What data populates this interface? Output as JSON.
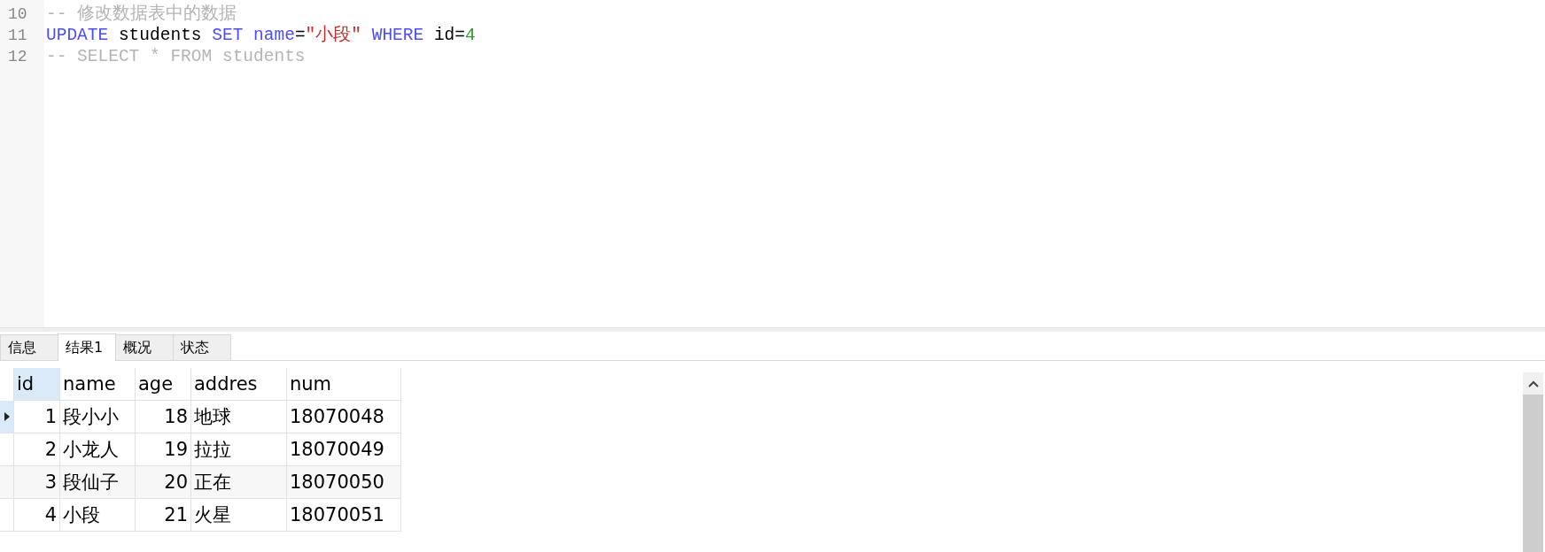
{
  "editor": {
    "lines": [
      {
        "number": "10",
        "tokens": [
          {
            "kind": "comment",
            "text": "-- 修改数据表中的数据"
          }
        ]
      },
      {
        "number": "11",
        "tokens": [
          {
            "kind": "keyword",
            "text": "UPDATE"
          },
          {
            "kind": "plain",
            "text": " students "
          },
          {
            "kind": "keyword",
            "text": "SET "
          },
          {
            "kind": "keyword",
            "text": "name"
          },
          {
            "kind": "plain",
            "text": "="
          },
          {
            "kind": "string",
            "text": "\"小段\" "
          },
          {
            "kind": "keyword",
            "text": "WHERE"
          },
          {
            "kind": "plain",
            "text": " id="
          },
          {
            "kind": "number",
            "text": "4"
          }
        ]
      },
      {
        "number": "12",
        "tokens": [
          {
            "kind": "comment",
            "text": "-- SELECT * FROM students"
          }
        ]
      }
    ]
  },
  "tabs": [
    {
      "label": "信息",
      "selected": false
    },
    {
      "label": "结果1",
      "selected": true
    },
    {
      "label": "概况",
      "selected": false
    },
    {
      "label": "状态",
      "selected": false
    }
  ],
  "table": {
    "columns": [
      {
        "label": "id",
        "selected": true
      },
      {
        "label": "name",
        "selected": false
      },
      {
        "label": "age",
        "selected": false
      },
      {
        "label": "addres",
        "selected": false
      },
      {
        "label": "num",
        "selected": false
      }
    ],
    "rows": [
      {
        "selected": true,
        "cells": [
          "1",
          "段小小",
          "18",
          "地球",
          "18070048"
        ]
      },
      {
        "selected": false,
        "cells": [
          "2",
          "小龙人",
          "19",
          "拉拉",
          "18070049"
        ]
      },
      {
        "selected": false,
        "cells": [
          "3",
          "段仙子",
          "20",
          "正在",
          "18070050"
        ]
      },
      {
        "selected": false,
        "cells": [
          "4",
          "小段",
          "21",
          "火星",
          "18070051"
        ]
      }
    ]
  }
}
